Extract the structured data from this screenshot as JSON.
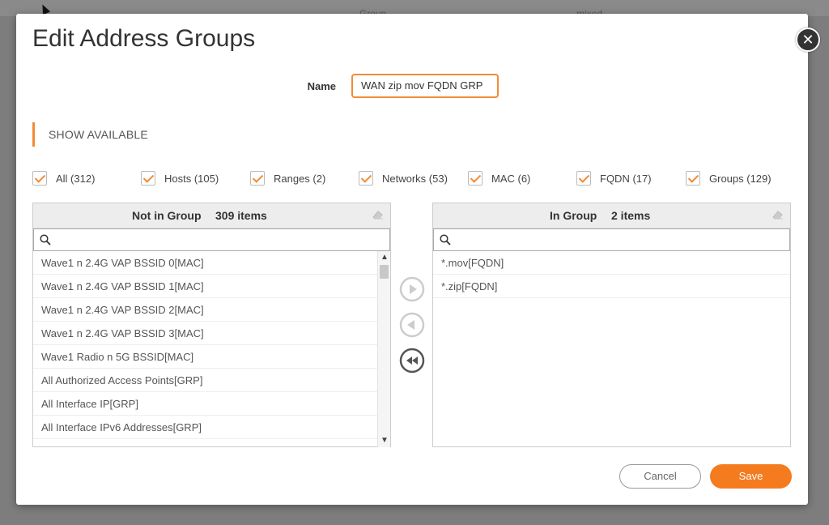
{
  "background": {
    "col_group": "Group",
    "col_mixed": "mixed"
  },
  "modal": {
    "title": "Edit Address Groups",
    "name_label": "Name",
    "name_value": "WAN zip mov FQDN GRP",
    "show_available": "SHOW AVAILABLE",
    "close_icon": "close-icon"
  },
  "filters": [
    {
      "label": "All (312)",
      "checked": true
    },
    {
      "label": "Hosts (105)",
      "checked": true
    },
    {
      "label": "Ranges (2)",
      "checked": true
    },
    {
      "label": "Networks (53)",
      "checked": true
    },
    {
      "label": "MAC (6)",
      "checked": true
    },
    {
      "label": "FQDN (17)",
      "checked": true
    },
    {
      "label": "Groups (129)",
      "checked": true
    }
  ],
  "not_in_group": {
    "title": "Not in Group",
    "count": "309 items",
    "search_placeholder": "",
    "items": [
      "Wave1 n 2.4G VAP BSSID 0[MAC]",
      "Wave1 n 2.4G VAP BSSID 1[MAC]",
      "Wave1 n 2.4G VAP BSSID 2[MAC]",
      "Wave1 n 2.4G VAP BSSID 3[MAC]",
      "Wave1 Radio n 5G BSSID[MAC]",
      "All Authorized Access Points[GRP]",
      "All Interface IP[GRP]",
      "All Interface IPv6 Addresses[GRP]"
    ]
  },
  "in_group": {
    "title": "In Group",
    "count": "2 items",
    "search_placeholder": "",
    "items": [
      "*.mov[FQDN]",
      "*.zip[FQDN]"
    ]
  },
  "buttons": {
    "cancel": "Cancel",
    "save": "Save"
  },
  "colors": {
    "accent": "#f28c36",
    "save_bg": "#f47c1f",
    "overlay": "#7d7d7d"
  }
}
